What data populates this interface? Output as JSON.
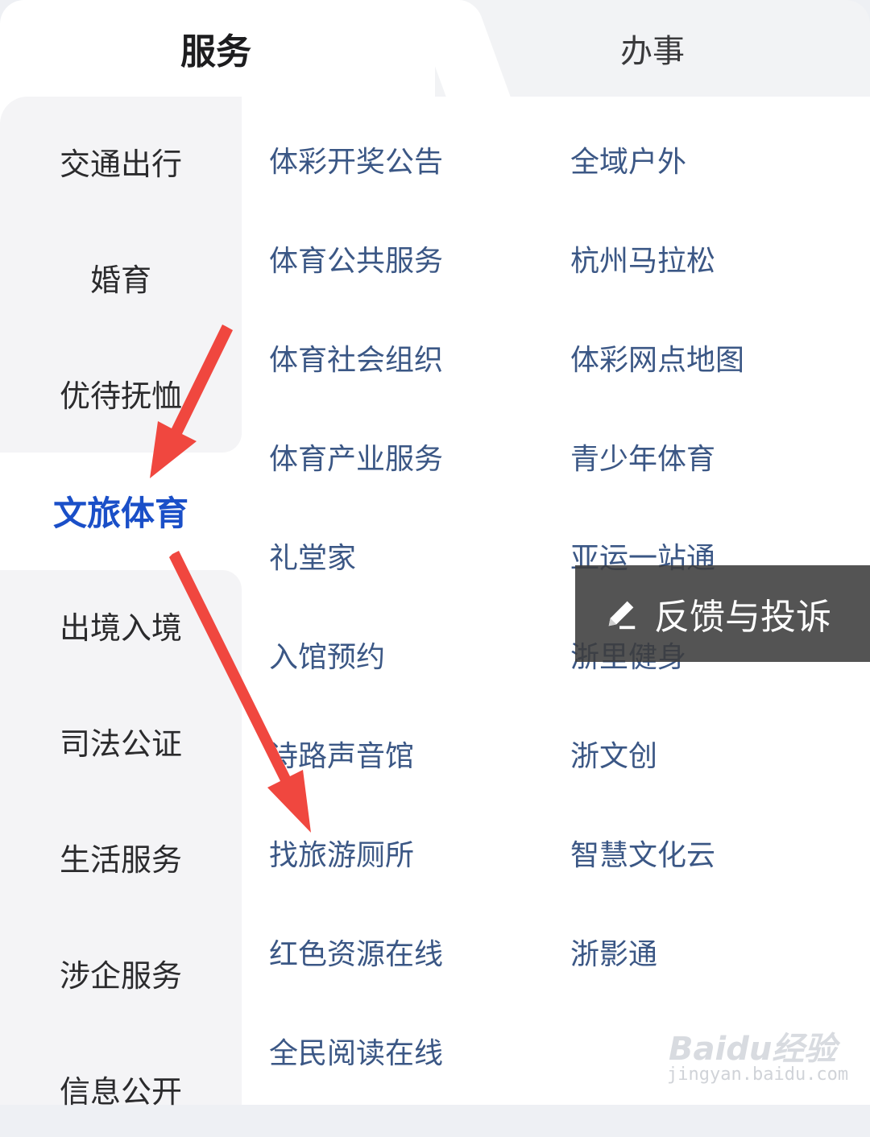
{
  "tabs": [
    {
      "label": "服务",
      "active": true
    },
    {
      "label": "办事",
      "active": false
    }
  ],
  "sidebar": {
    "items": [
      {
        "label": "交通出行"
      },
      {
        "label": "婚育"
      },
      {
        "label": "优待抚恤"
      },
      {
        "label": "文旅体育",
        "active": true
      },
      {
        "label": "出境入境"
      },
      {
        "label": "司法公证"
      },
      {
        "label": "生活服务"
      },
      {
        "label": "涉企服务"
      },
      {
        "label": "信息公开"
      }
    ]
  },
  "services": {
    "left": [
      "体彩开奖公告",
      "体育公共服务",
      "体育社会组织",
      "体育产业服务",
      "礼堂家",
      "入馆预约",
      "诗路声音馆",
      "找旅游厕所",
      "红色资源在线",
      "全民阅读在线"
    ],
    "right": [
      "全域户外",
      "杭州马拉松",
      "体彩网点地图",
      "青少年体育",
      "亚运一站通",
      "浙里健身",
      "浙文创",
      "智慧文化云",
      "浙影通"
    ]
  },
  "feedback": {
    "label": "反馈与投诉",
    "icon": "pencil-icon"
  },
  "watermark": {
    "main": "Baidu经验",
    "sub": "jingyan.baidu.com"
  },
  "colors": {
    "active_tab_text": "#1d1d1f",
    "sidebar_active": "#1a4fc8",
    "service_text": "#3b5785",
    "annotation_arrow": "#f0473f"
  }
}
